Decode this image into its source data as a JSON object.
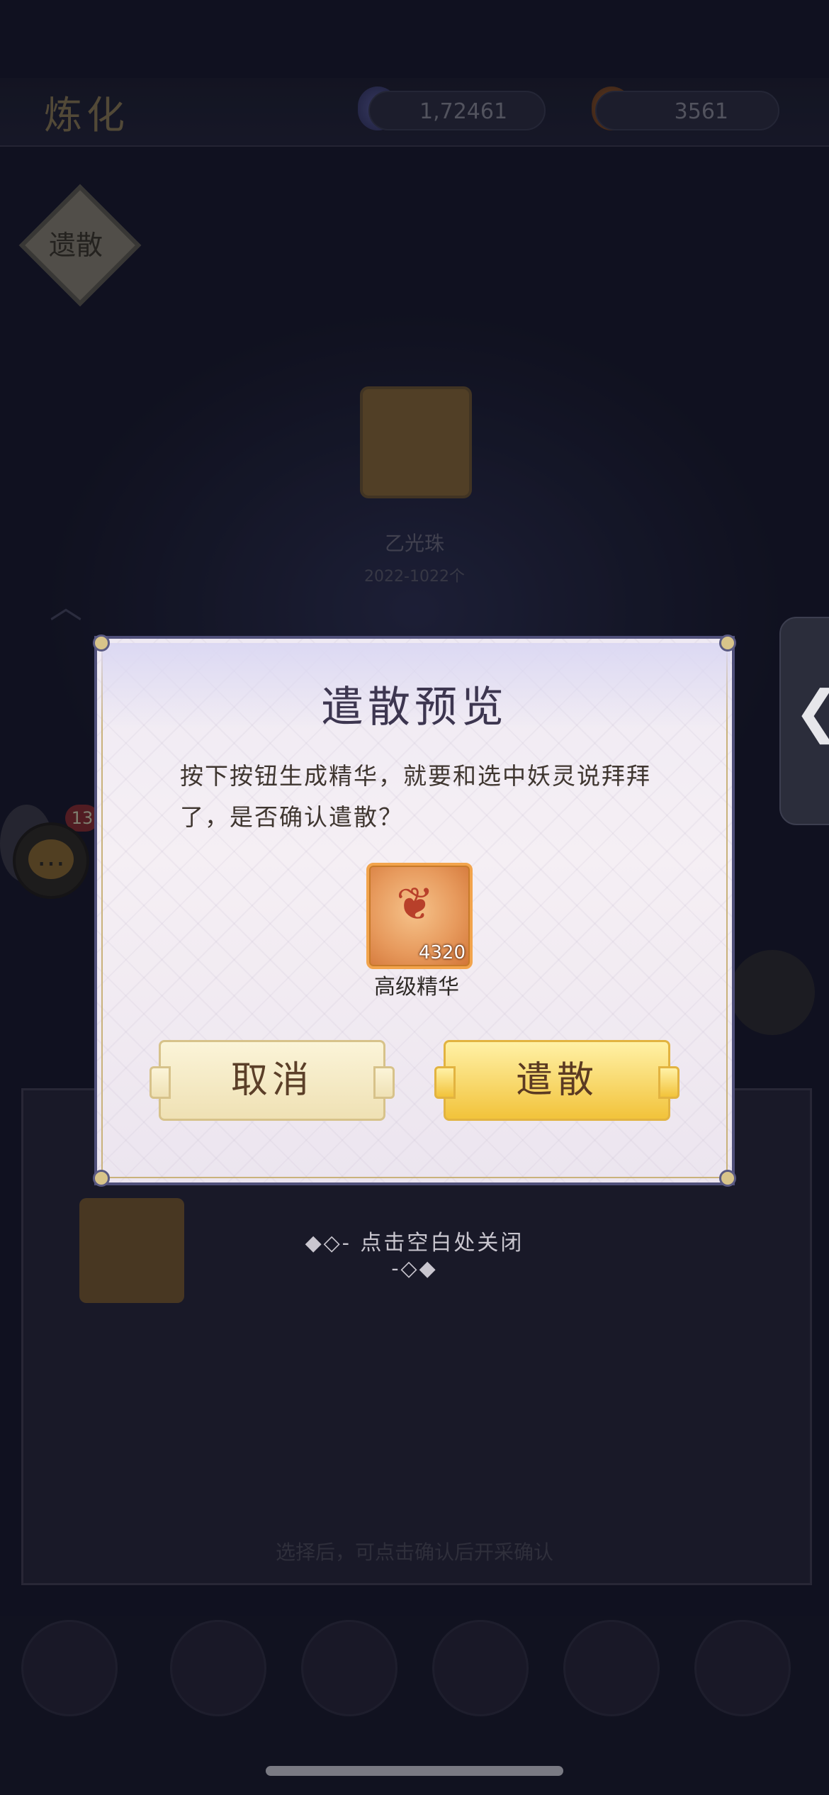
{
  "background": {
    "title": "炼化",
    "resources": [
      "1,72461",
      "3561"
    ],
    "diamond_label": "遗散",
    "pet_name": "乙光珠",
    "pet_subtitle": "2022-1022个",
    "chat_badge": "13",
    "panel_hint": "选择后，可点击确认后开采确认"
  },
  "dialog": {
    "title": "遣散预览",
    "message": "按下按钮生成精华，就要和选中妖灵说拜拜了，是否确认遣散？",
    "item": {
      "name": "高级精华",
      "count": "4320"
    },
    "cancel_label": "取消",
    "confirm_label": "遣散"
  },
  "close_hint": "◆◇- 点击空白处关闭 -◇◆",
  "side_tab_icon": "chevron-left-icon",
  "colors": {
    "dialog_bg": "#f3eef4",
    "confirm_button": "#f2c33b",
    "cancel_button": "#efe1b4"
  }
}
